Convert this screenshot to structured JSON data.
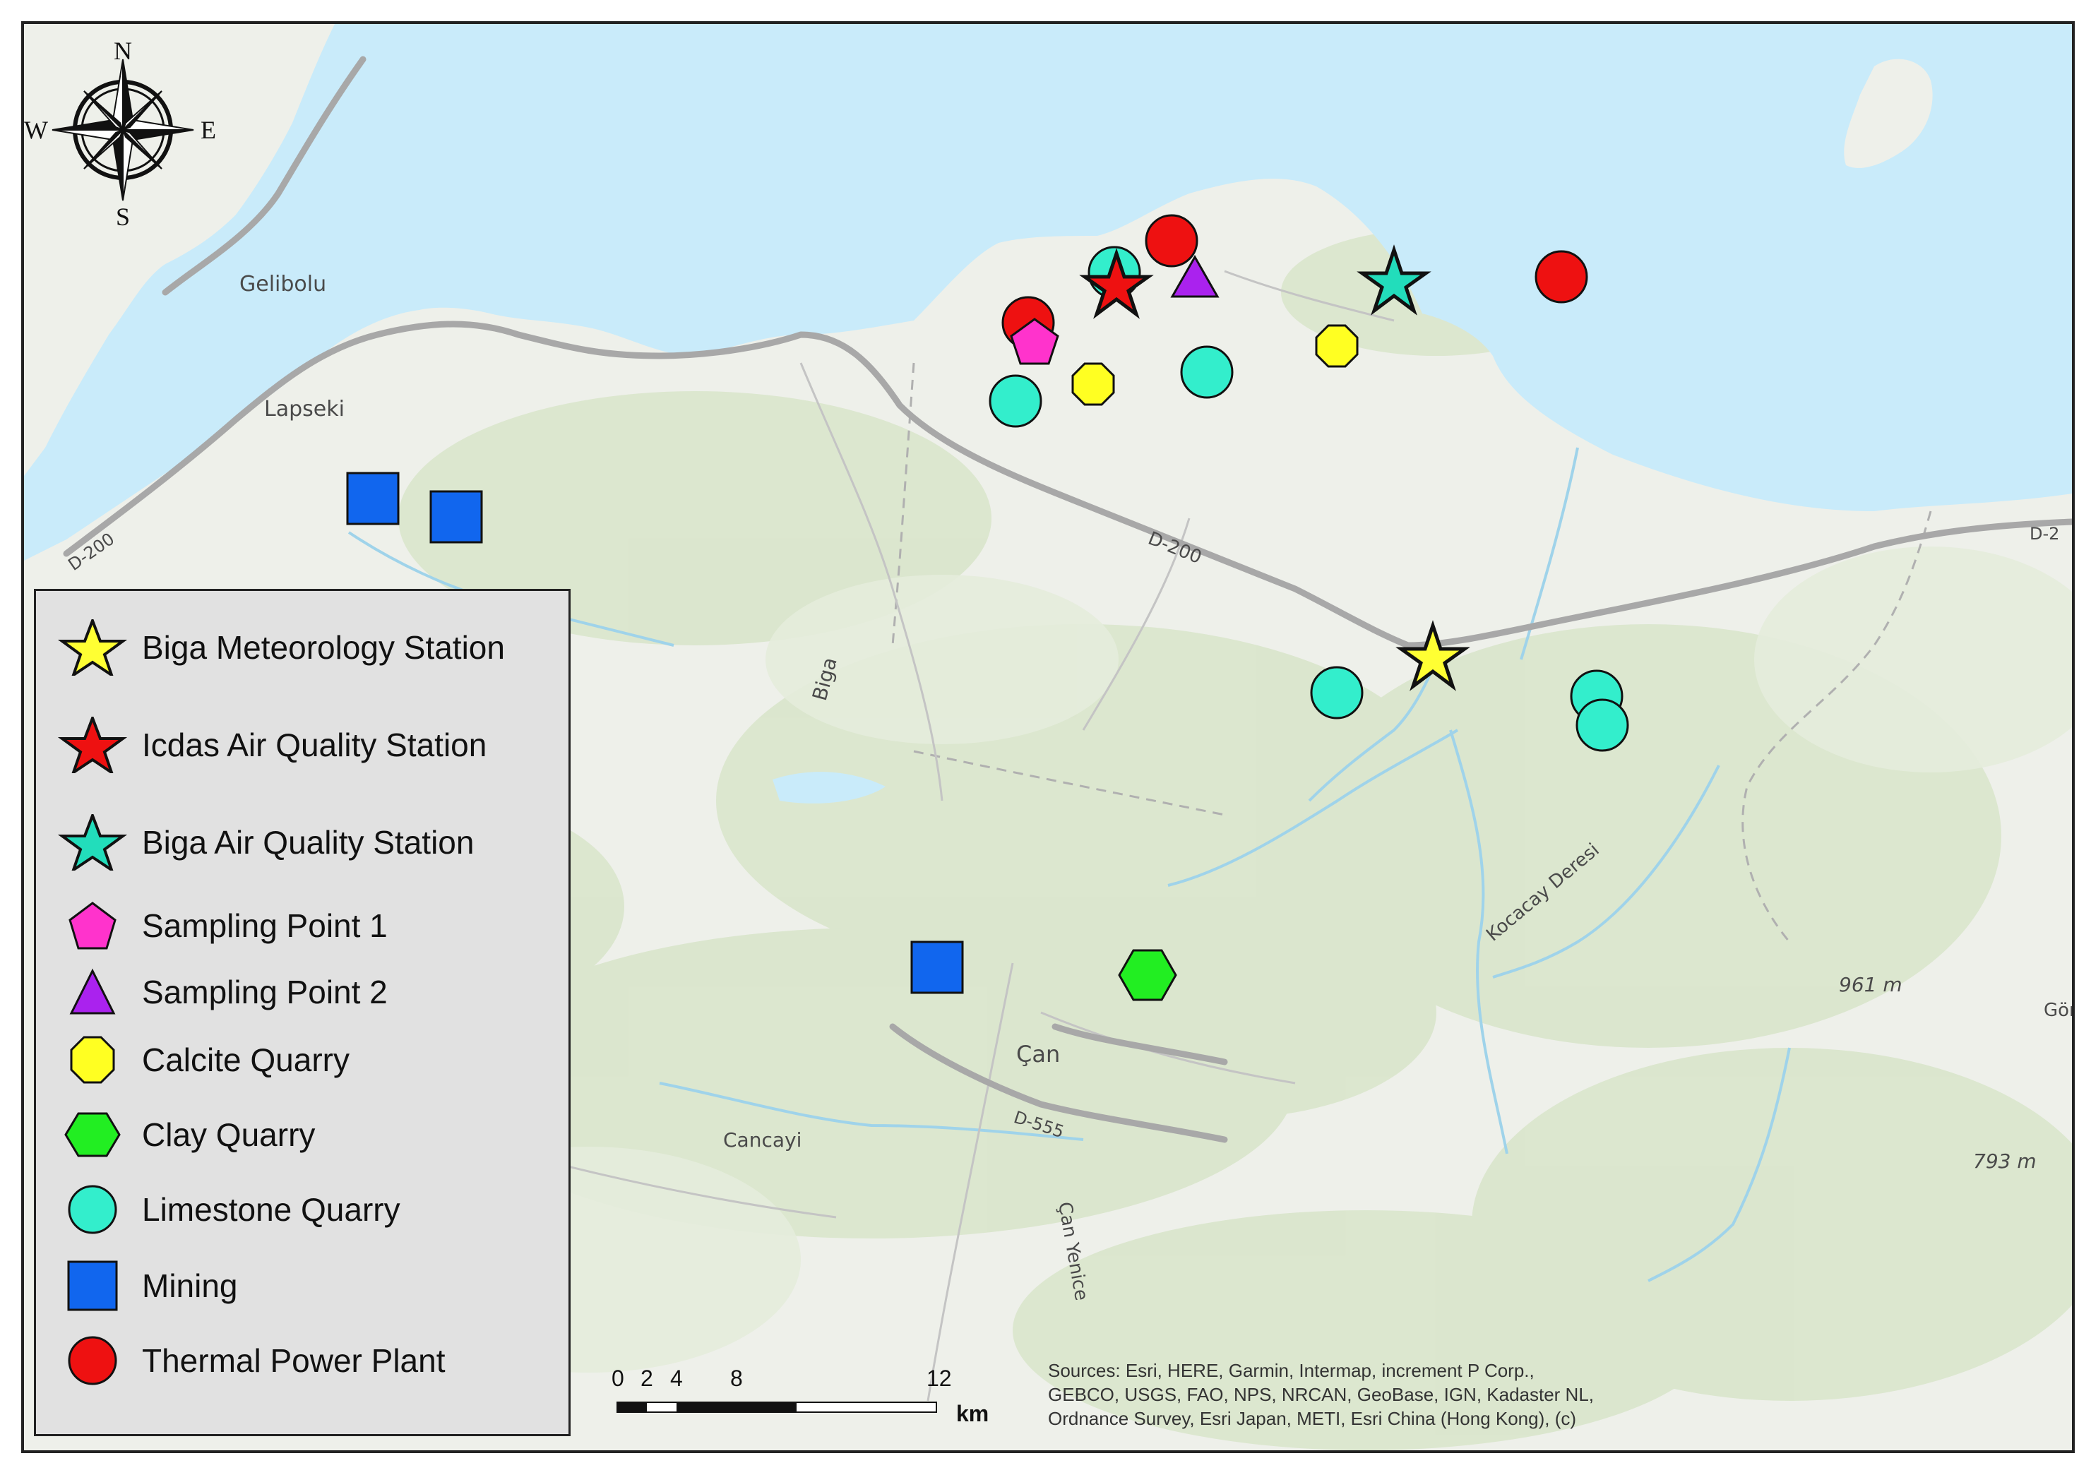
{
  "places": {
    "gelibolu": "Gelibolu",
    "lapseki": "Lapseki",
    "biga": "Biga",
    "can": "Çan",
    "cancayi": "Cancayi",
    "can_yenice": "Çan Yenice",
    "kocacay": "Kocacay Deresi",
    "road_d200_west": "D-200",
    "road_d200_mid": "D-200",
    "road_d200_east": "D-2",
    "road_d555": "D-555",
    "elev_961": "961 m",
    "elev_793": "793 m",
    "gon": "Gön"
  },
  "compass": {
    "north": "N",
    "south": "S",
    "east": "E",
    "west": "W"
  },
  "legend": {
    "items": [
      {
        "label": "Biga Meteorology Station",
        "symbol": "star",
        "color": "#ffff33"
      },
      {
        "label": "Icdas Air Quality Station",
        "symbol": "star",
        "color": "#ee1111"
      },
      {
        "label": "Biga Air Quality Station",
        "symbol": "star",
        "color": "#22ddbb"
      },
      {
        "label": "Sampling Point 1",
        "symbol": "pentagon",
        "color": "#ff33cc"
      },
      {
        "label": "Sampling Point 2",
        "symbol": "triangle",
        "color": "#aa22ee"
      },
      {
        "label": "Calcite Quarry",
        "symbol": "octagon",
        "color": "#ffff22"
      },
      {
        "label": "Clay Quarry",
        "symbol": "hexagon",
        "color": "#22ee22"
      },
      {
        "label": "Limestone Quarry",
        "symbol": "circle",
        "color": "#33eecc"
      },
      {
        "label": "Mining",
        "symbol": "square",
        "color": "#1166ee"
      },
      {
        "label": "Thermal Power Plant",
        "symbol": "circle",
        "color": "#ee1111"
      }
    ]
  },
  "scale": {
    "ticks": [
      "0",
      "2",
      "4",
      "8",
      "12"
    ],
    "unit": "km"
  },
  "attribution": {
    "line1": "Sources: Esri, HERE, Garmin, Intermap, increment P Corp.,",
    "line2": "GEBCO, USGS, FAO, NPS, NRCAN, GeoBase, IGN, Kadaster NL,",
    "line3": "Ordnance Survey, Esri Japan, METI, Esri China (Hong Kong), (c)"
  },
  "colors": {
    "sea": "#c9ebfa",
    "land": "#eef0ea",
    "forest": "#d9e6cc",
    "river": "#9fd3ea",
    "road": "#a8a8a8"
  }
}
